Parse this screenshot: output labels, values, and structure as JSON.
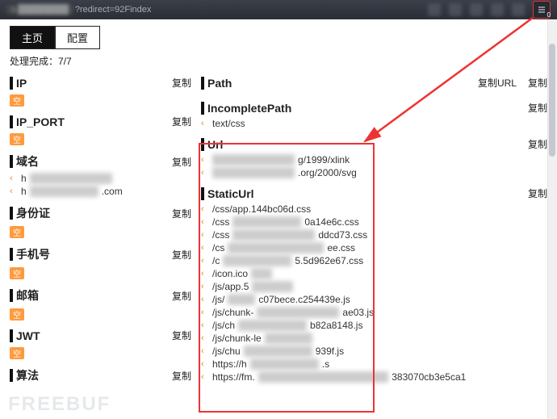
{
  "topbar": {
    "url_obscured": "s.████████",
    "url_visible": "?redirect=92Findex",
    "ext_badge": "0"
  },
  "tabs": {
    "home": "主页",
    "config": "配置"
  },
  "progress": {
    "label": "处理完成：",
    "value": "7/7"
  },
  "copy": "复制",
  "copy_url": "复制URL",
  "empty_badge": "空",
  "left_sections": [
    {
      "title": "IP",
      "empty": true,
      "items": []
    },
    {
      "title": "IP_PORT",
      "empty": true,
      "items": []
    },
    {
      "title": "域名",
      "empty": false,
      "items": [
        {
          "pre": "h",
          "blur": "████████████",
          "post": ""
        },
        {
          "pre": "h",
          "blur": "██████████",
          "post": ".com"
        }
      ]
    },
    {
      "title": "身份证",
      "empty": true,
      "items": []
    },
    {
      "title": "手机号",
      "empty": true,
      "items": []
    },
    {
      "title": "邮箱",
      "empty": true,
      "items": []
    },
    {
      "title": "JWT",
      "empty": true,
      "items": []
    },
    {
      "title": "算法",
      "empty": false,
      "items": []
    }
  ],
  "right_sections": [
    {
      "title": "Path",
      "copy_url": true,
      "items": []
    },
    {
      "title": "IncompletePath",
      "copy_url": false,
      "items": [
        {
          "pre": "text/css",
          "blur": "",
          "post": ""
        }
      ]
    },
    {
      "title": "Url",
      "copy_url": false,
      "items": [
        {
          "pre": "",
          "blur": "████████████",
          "post": "g/1999/xlink"
        },
        {
          "pre": "",
          "blur": "████████████",
          "post": ".org/2000/svg"
        }
      ]
    },
    {
      "title": "StaticUrl",
      "copy_url": false,
      "items": [
        {
          "pre": "/css/app.144bc06d.css",
          "blur": "",
          "post": ""
        },
        {
          "pre": "/css",
          "blur": "██████████",
          "post": "0a14e6c.css"
        },
        {
          "pre": "/css",
          "blur": "████████████",
          "post": "ddcd73.css"
        },
        {
          "pre": "/cs",
          "blur": "██████████████",
          "post": "ee.css"
        },
        {
          "pre": "/c",
          "blur": "██████████",
          "post": "5.5d962e67.css"
        },
        {
          "pre": "/icon.ico",
          "blur": "███",
          "post": ""
        },
        {
          "pre": "/js/app.5",
          "blur": "██████",
          "post": ""
        },
        {
          "pre": "/js/",
          "blur": "████",
          "post": "c07bece.c254439e.js"
        },
        {
          "pre": "/js/chunk-",
          "blur": "████████████",
          "post": "ae03.js"
        },
        {
          "pre": "/js/ch",
          "blur": "██████████",
          "post": "b82a8148.js"
        },
        {
          "pre": "/js/chunk-le",
          "blur": "███████",
          "post": ""
        },
        {
          "pre": "/js/chu",
          "blur": "██████████",
          "post": "939f.js"
        },
        {
          "pre": "https://h",
          "blur": "██████████",
          "post": ".s"
        },
        {
          "pre": "https://fm.",
          "blur": "███████████████████",
          "post": "383070cb3e5ca1"
        }
      ]
    }
  ],
  "watermark": "FREEBUF"
}
